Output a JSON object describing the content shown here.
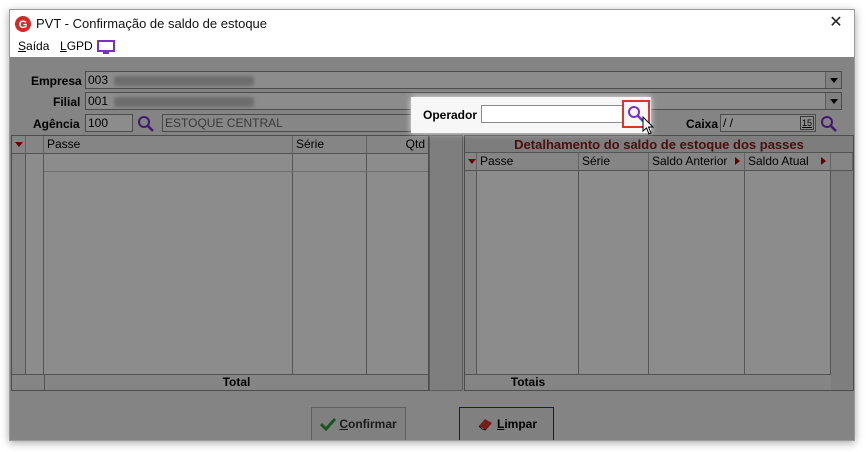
{
  "window": {
    "title": "PVT - Confirmação de saldo de estoque",
    "close_glyph": "✕"
  },
  "menu": {
    "saida": {
      "underline": "S",
      "rest": "aída"
    },
    "lgpd": {
      "underline": "L",
      "rest": "GPD"
    },
    "monitor_icon": "monitor-icon"
  },
  "form": {
    "empresa_label": "Empresa",
    "empresa_value": "003",
    "filial_label": "Filial",
    "filial_value": "001",
    "agencia_label": "Agência",
    "agencia_value": "100",
    "agencia_name": "ESTOQUE CENTRAL",
    "operador_label": "Operador",
    "operador_value": "",
    "caixa_label": "Caixa",
    "caixa_value": " / /",
    "caixa_calendar": "15"
  },
  "left_grid": {
    "columns": [
      "Passe",
      "Série",
      "Qtd"
    ],
    "footer": "Total"
  },
  "right_grid": {
    "title": "Detalhamento do saldo de estoque dos passes",
    "columns": [
      "Passe",
      "Série",
      "Saldo Anterior",
      "Saldo Atual"
    ],
    "footer": "Totais"
  },
  "buttons": {
    "confirmar": {
      "underline": "C",
      "rest": "onfirmar"
    },
    "limpar": {
      "underline": "L",
      "rest": "impar"
    }
  },
  "colors": {
    "accent_purple": "#7a2fc9",
    "highlight_red": "#e03030",
    "detail_title": "#8b1a1a"
  }
}
